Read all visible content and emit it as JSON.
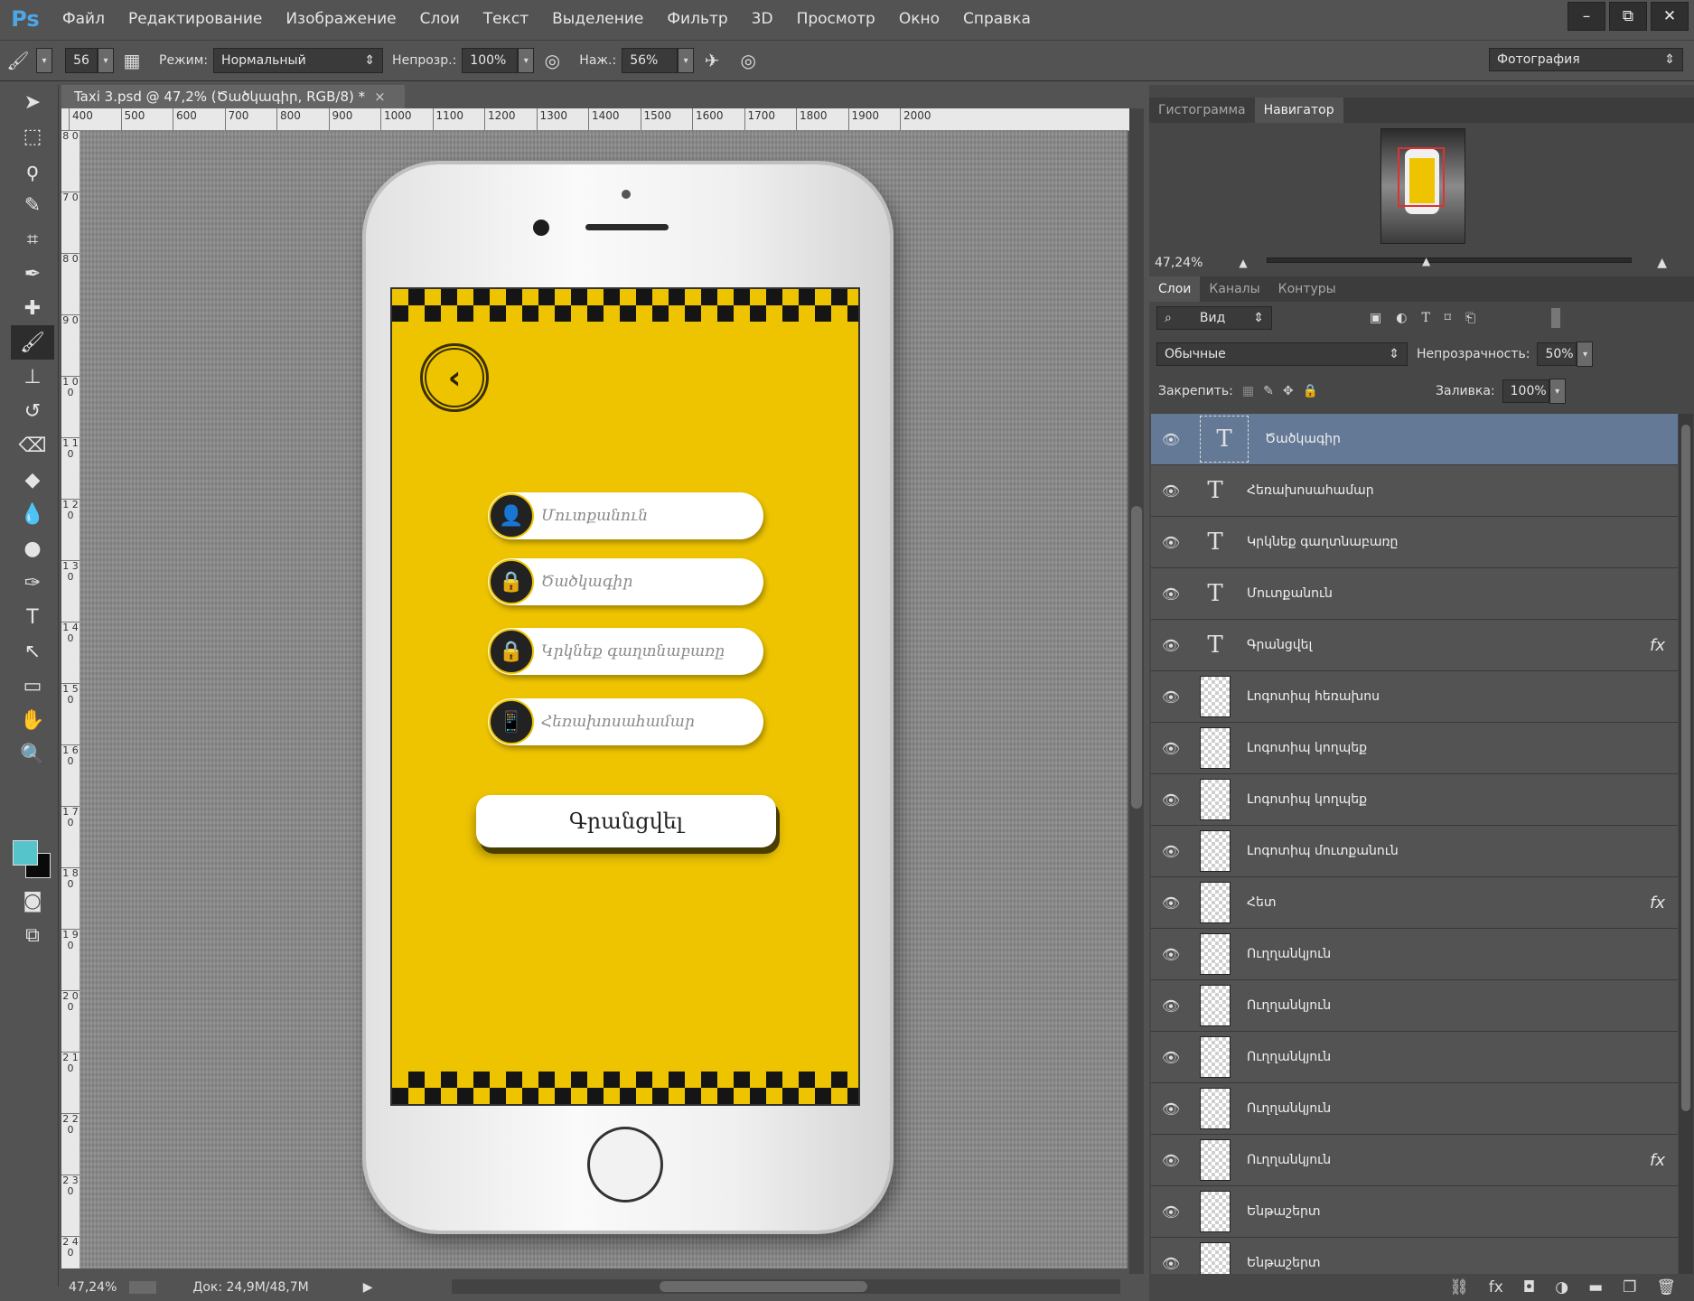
{
  "app": {
    "logo": "Ps"
  },
  "menu": [
    "Файл",
    "Редактирование",
    "Изображение",
    "Слои",
    "Текст",
    "Выделение",
    "Фильтр",
    "3D",
    "Просмотр",
    "Окно",
    "Справка"
  ],
  "window_buttons": [
    "–",
    "⧉",
    "✕"
  ],
  "options": {
    "brush_size": "56",
    "mode_label": "Режим:",
    "mode_value": "Нормальный",
    "opacity_label": "Непрозр.:",
    "opacity_value": "100%",
    "pressure_label": "Наж.:",
    "pressure_value": "56%",
    "workspace": "Фотография"
  },
  "document": {
    "tab_title": "Taxi 3.psd @ 47,2% (Ծածկագիր, RGB/8) *",
    "close": "×",
    "h_ruler": [
      "400",
      "500",
      "600",
      "700",
      "800",
      "900",
      "1000",
      "1100",
      "1200",
      "1300",
      "1400",
      "1500",
      "1600",
      "1700",
      "1800",
      "1900",
      "2000"
    ],
    "v_ruler": [
      "8 0",
      "7 0",
      "8 0",
      "9 0",
      "1 0 0",
      "1 1 0",
      "1 2 0",
      "1 3 0",
      "1 4 0",
      "1 5 0",
      "1 6 0",
      "1 7 0",
      "1 8 0",
      "1 9 0",
      "2 0 0",
      "2 1 0",
      "2 2 0",
      "2 3 0",
      "2 4 0"
    ]
  },
  "phone_screen": {
    "back_icon": "‹",
    "fields": [
      {
        "icon": "user-icon",
        "glyph": "👤",
        "placeholder": "Մուտքանուն"
      },
      {
        "icon": "lock-icon",
        "glyph": "🔒",
        "placeholder": "Ծածկագիր"
      },
      {
        "icon": "lock-icon",
        "glyph": "🔒",
        "placeholder": "Կրկնեք գաղտնաբառը"
      },
      {
        "icon": "phone-icon",
        "glyph": "📱",
        "placeholder": "Հեռախոսահամար"
      }
    ],
    "register_button": "Գրանցվել",
    "screen_color": "#eec400"
  },
  "status": {
    "zoom": "47,24%",
    "doc_info": "Док: 24,9M/48,7M"
  },
  "navigator": {
    "tabs": [
      "Гистограмма",
      "Навигатор"
    ],
    "active_tab": "Навигатор",
    "zoom": "47,24%"
  },
  "layers_panel": {
    "tabs": [
      "Слои",
      "Каналы",
      "Контуры"
    ],
    "filter_label": "Вид",
    "blend_mode": "Обычные",
    "opacity_label": "Непрозрачность:",
    "opacity_value": "50%",
    "lock_label": "Закрепить:",
    "fill_label": "Заливка:",
    "fill_value": "100%",
    "layers": [
      {
        "type": "text",
        "name": "Ծածկագիր",
        "selected": true,
        "fx": false
      },
      {
        "type": "text",
        "name": "Հեռախոսահամար",
        "selected": false,
        "fx": false
      },
      {
        "type": "text",
        "name": "Կրկնեք գաղտնաբառը",
        "selected": false,
        "fx": false
      },
      {
        "type": "text",
        "name": "Մուտքանուն",
        "selected": false,
        "fx": false
      },
      {
        "type": "text",
        "name": "Գրանցվել",
        "selected": false,
        "fx": true
      },
      {
        "type": "raster",
        "name": "Լոգոտիպ հեռախոս",
        "selected": false,
        "fx": false
      },
      {
        "type": "raster",
        "name": "Լոգոտիպ կողպեք",
        "selected": false,
        "fx": false
      },
      {
        "type": "raster",
        "name": "Լոգոտիպ կողպեք",
        "selected": false,
        "fx": false
      },
      {
        "type": "raster",
        "name": "Լոգոտիպ մուտքանուն",
        "selected": false,
        "fx": false
      },
      {
        "type": "raster",
        "name": "Հետ",
        "selected": false,
        "fx": true
      },
      {
        "type": "shape",
        "name": "Ուղղանկյուն",
        "selected": false,
        "fx": false
      },
      {
        "type": "shape",
        "name": "Ուղղանկյուն",
        "selected": false,
        "fx": false
      },
      {
        "type": "shape",
        "name": "Ուղղանկյուն",
        "selected": false,
        "fx": false
      },
      {
        "type": "shape",
        "name": "Ուղղանկյուն",
        "selected": false,
        "fx": false
      },
      {
        "type": "shape",
        "name": "Ուղղանկյուն",
        "selected": false,
        "fx": true
      },
      {
        "type": "raster",
        "name": "Ենթաշերտ",
        "selected": false,
        "fx": false
      },
      {
        "type": "raster",
        "name": "Ենթաշերտ",
        "selected": false,
        "fx": false
      }
    ],
    "footer_icons": [
      "link-icon",
      "fx-icon",
      "mask-icon",
      "adjustment-icon",
      "folder-icon",
      "new-layer-icon",
      "trash-icon"
    ]
  }
}
